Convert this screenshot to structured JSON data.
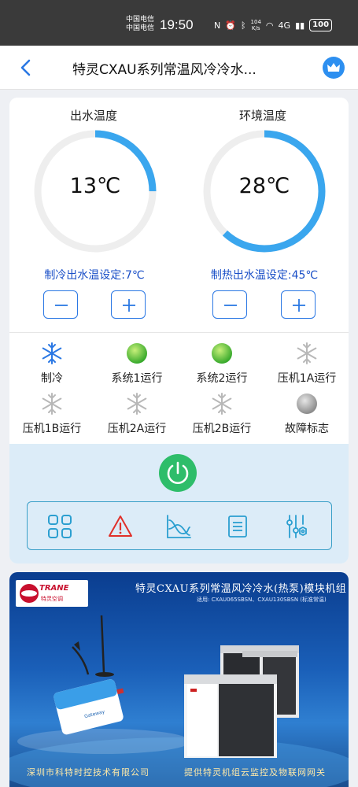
{
  "status_bar": {
    "carrier1": "中国电信",
    "carrier2": "中国电信",
    "time": "19:50",
    "speed_value": "104",
    "speed_unit": "K/s",
    "network": "4G",
    "battery": "100"
  },
  "header": {
    "title": "特灵CXAU系列常温风冷冷水..."
  },
  "gauges": [
    {
      "label": "出水温度",
      "value": "13℃",
      "fill_fraction": 0.25,
      "setpoint": "制冷出水温设定:7℃"
    },
    {
      "label": "环境温度",
      "value": "28℃",
      "fill_fraction": 0.62,
      "setpoint": "制热出水温设定:45℃"
    }
  ],
  "controls": {
    "minus": "−",
    "plus": "+"
  },
  "statuses": [
    {
      "label": "制冷",
      "icon": "snowflake-icon",
      "state": "active"
    },
    {
      "label": "系统1运行",
      "icon": "green-dot-icon",
      "state": "on"
    },
    {
      "label": "系统2运行",
      "icon": "green-dot-icon",
      "state": "on"
    },
    {
      "label": "压机1A运行",
      "icon": "snowflake-icon",
      "state": "off"
    },
    {
      "label": "压机1B运行",
      "icon": "snowflake-icon",
      "state": "off"
    },
    {
      "label": "压机2A运行",
      "icon": "snowflake-icon",
      "state": "off"
    },
    {
      "label": "压机2B运行",
      "icon": "snowflake-icon",
      "state": "off"
    },
    {
      "label": "故障标志",
      "icon": "gray-dot-icon",
      "state": "off"
    }
  ],
  "toolbar": [
    "grid-icon",
    "warning-icon",
    "chart-icon",
    "list-icon",
    "settings-sliders-icon"
  ],
  "banner": {
    "brand": "TRANE",
    "brand_cn": "特灵空调",
    "title": "特灵CXAU系列常温风冷冷水(热泵)模块机组",
    "subtitle": "适用: CXAU065SBSN、CXAU130SBSN (标准常温)",
    "gateway_label": "Gateway",
    "footer_left": "深圳市科特时控技术有限公司",
    "footer_right": "提供特灵机组云监控及物联网网关"
  },
  "colors": {
    "accent": "#2b78e4",
    "setpoint_text": "#1a4fc7",
    "gauge_fill": "#3aa6ee",
    "gauge_track": "#eeeeee",
    "power": "#2ebd6a",
    "on_green": "#57c43c"
  }
}
